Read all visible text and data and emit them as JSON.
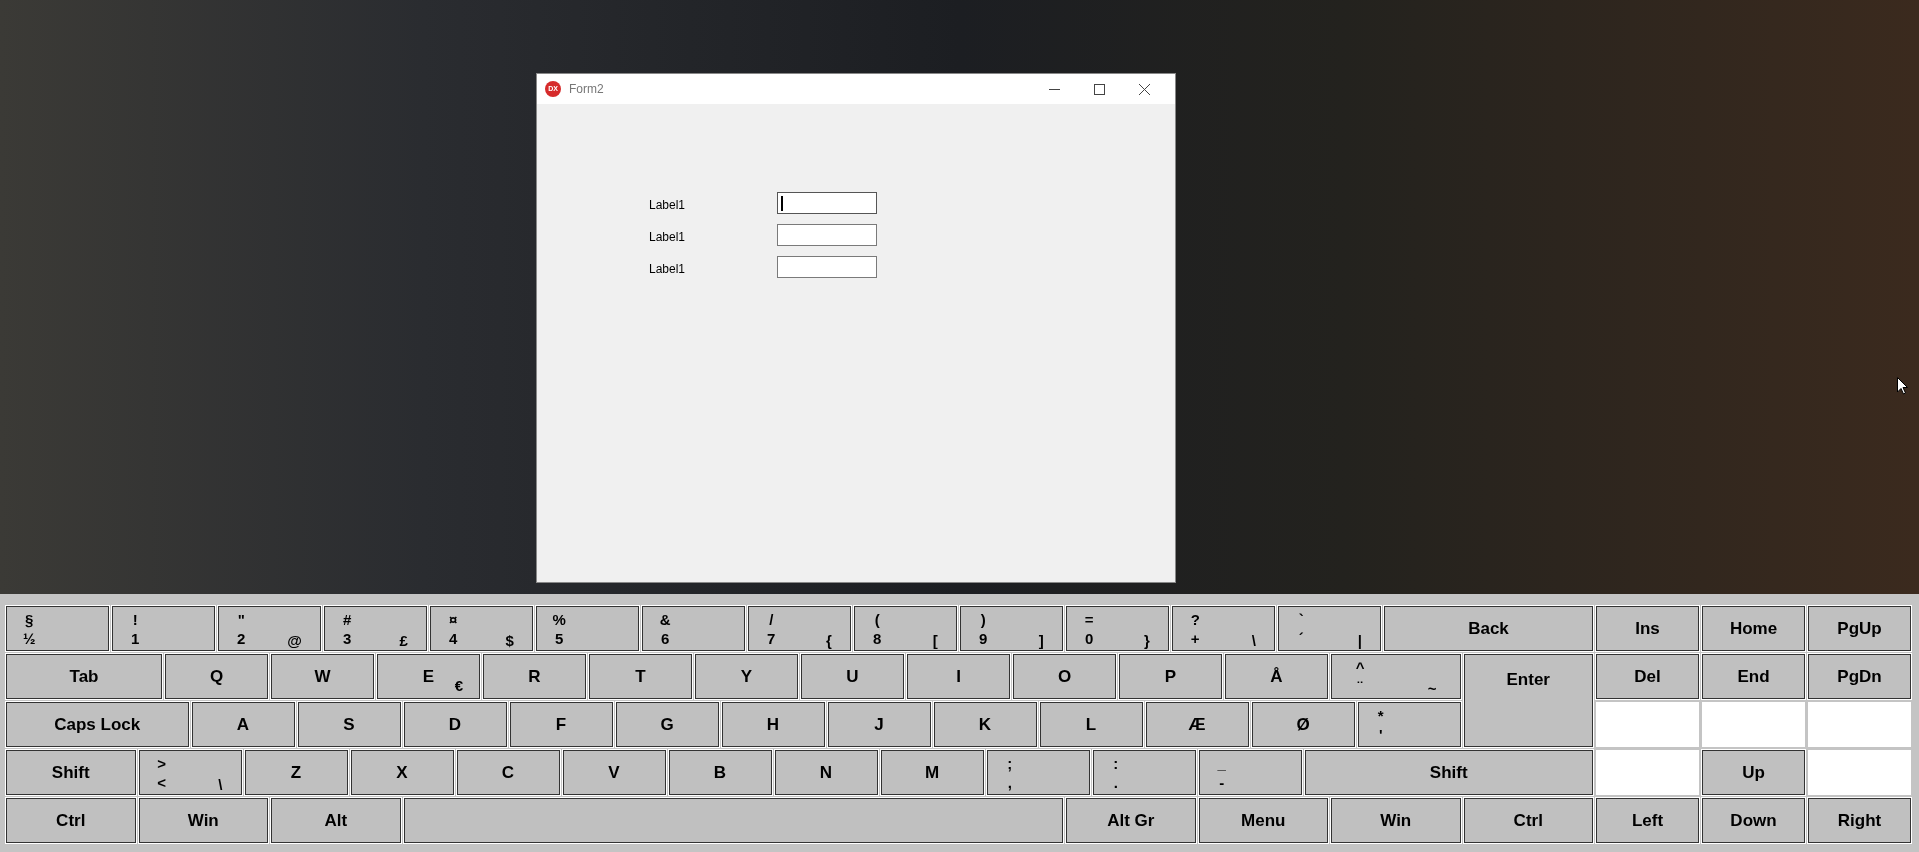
{
  "form_window": {
    "app_icon_text": "DX",
    "title": "Form2",
    "fields": [
      {
        "label": "Label1",
        "focused": true
      },
      {
        "label": "Label1",
        "focused": false
      },
      {
        "label": "Label1",
        "focused": false
      }
    ]
  },
  "keyboard": {
    "main_rows": [
      [
        {
          "shift": "§",
          "base": "½"
        },
        {
          "shift": "!",
          "base": "1"
        },
        {
          "shift": "\"",
          "base": "2",
          "altgr": "@"
        },
        {
          "shift": "#",
          "base": "3",
          "altgr": "£"
        },
        {
          "shift": "¤",
          "base": "4",
          "altgr": "$"
        },
        {
          "shift": "%",
          "base": "5"
        },
        {
          "shift": "&",
          "base": "6"
        },
        {
          "shift": "/",
          "base": "7",
          "altgr": "{"
        },
        {
          "shift": "(",
          "base": "8",
          "altgr": "["
        },
        {
          "shift": ")",
          "base": "9",
          "altgr": "]"
        },
        {
          "shift": "=",
          "base": "0",
          "altgr": "}"
        },
        {
          "shift": "?",
          "base": "+",
          "altgr": "\\"
        },
        {
          "shift": "`",
          "base": "´",
          "altgr": "|"
        },
        {
          "label": "Back"
        }
      ],
      [
        {
          "label": "Tab"
        },
        {
          "label": "Q"
        },
        {
          "label": "W"
        },
        {
          "label": "E",
          "altgr": "€"
        },
        {
          "label": "R"
        },
        {
          "label": "T"
        },
        {
          "label": "Y"
        },
        {
          "label": "U"
        },
        {
          "label": "I"
        },
        {
          "label": "O"
        },
        {
          "label": "P"
        },
        {
          "label": "Å"
        },
        {
          "shift": "^",
          "base": "¨",
          "altgr": "~"
        }
      ],
      [
        {
          "label": "Caps Lock"
        },
        {
          "label": "A"
        },
        {
          "label": "S"
        },
        {
          "label": "D"
        },
        {
          "label": "F"
        },
        {
          "label": "G"
        },
        {
          "label": "H"
        },
        {
          "label": "J"
        },
        {
          "label": "K"
        },
        {
          "label": "L"
        },
        {
          "label": "Æ"
        },
        {
          "label": "Ø"
        },
        {
          "shift": "*",
          "base": "'"
        }
      ],
      [
        {
          "label": "Shift"
        },
        {
          "shift": ">",
          "base": "<",
          "altgr": "\\"
        },
        {
          "label": "Z"
        },
        {
          "label": "X"
        },
        {
          "label": "C"
        },
        {
          "label": "V"
        },
        {
          "label": "B"
        },
        {
          "label": "N"
        },
        {
          "label": "M"
        },
        {
          "shift": ";",
          "base": ","
        },
        {
          "shift": ":",
          "base": "."
        },
        {
          "shift": "_",
          "base": "-"
        },
        {
          "label": "Shift"
        }
      ],
      [
        {
          "label": "Ctrl"
        },
        {
          "label": "Win"
        },
        {
          "label": "Alt"
        },
        {
          "kind": "space"
        },
        {
          "label": "Alt Gr"
        },
        {
          "label": "Menu"
        },
        {
          "label": "Win"
        },
        {
          "label": "Ctrl"
        }
      ]
    ],
    "enter": {
      "label": "Enter"
    },
    "nav_rows": [
      [
        {
          "label": "Ins"
        },
        {
          "label": "Home"
        },
        {
          "label": "PgUp"
        }
      ],
      [
        {
          "label": "Del"
        },
        {
          "label": "End"
        },
        {
          "label": "PgDn"
        }
      ],
      [
        {
          "kind": "gap"
        },
        {
          "kind": "gap"
        },
        {
          "kind": "gap"
        }
      ],
      [
        {
          "kind": "gap"
        },
        {
          "label": "Up"
        },
        {
          "kind": "gap"
        }
      ],
      [
        {
          "label": "Left"
        },
        {
          "label": "Down"
        },
        {
          "label": "Right"
        }
      ]
    ]
  }
}
